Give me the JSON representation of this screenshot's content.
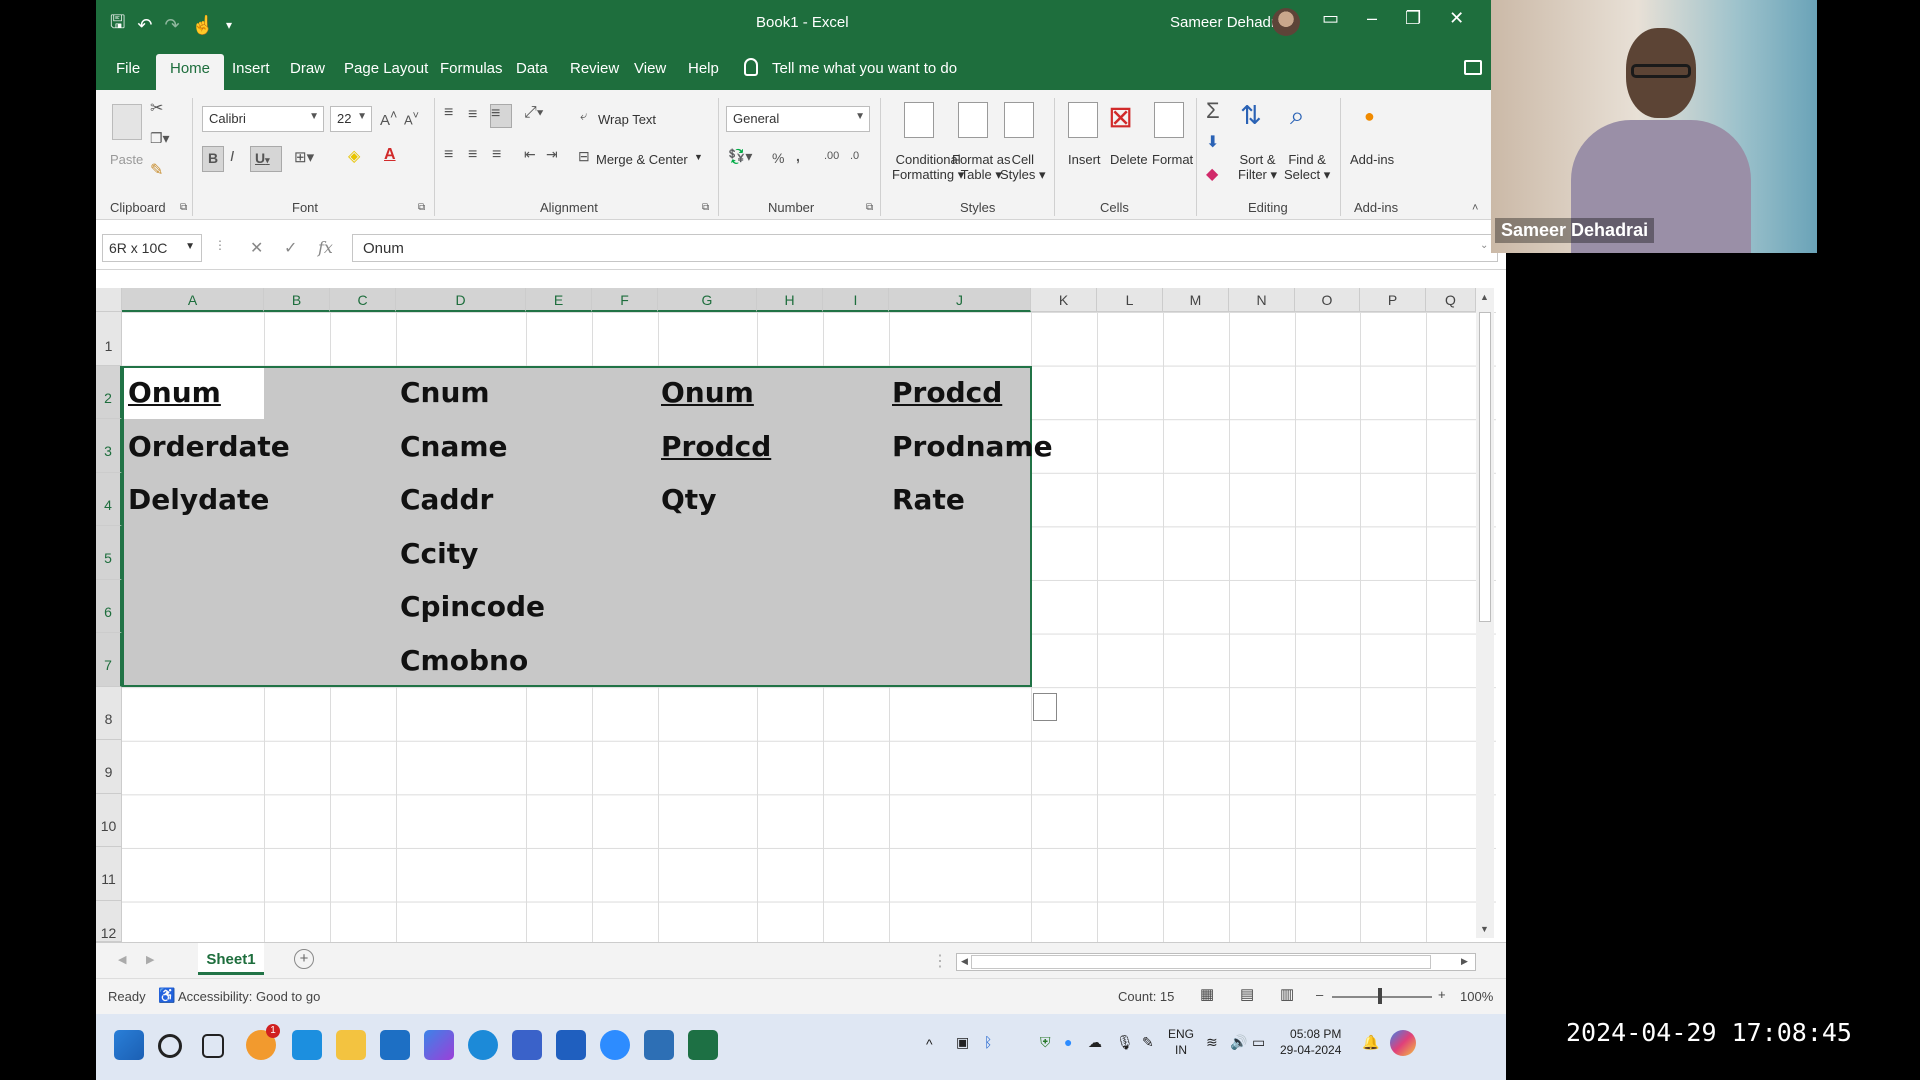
{
  "window": {
    "title": "Book1  -  Excel",
    "user": "Sameer Dehadrai"
  },
  "menu": {
    "tabs": [
      "File",
      "Home",
      "Insert",
      "Draw",
      "Page Layout",
      "Formulas",
      "Data",
      "Review",
      "View",
      "Help"
    ],
    "active_tab": "Home",
    "tell_me": "Tell me what you want to do"
  },
  "ribbon": {
    "clipboard": {
      "label": "Clipboard",
      "paste": "Paste"
    },
    "font": {
      "label": "Font",
      "name": "Calibri",
      "size": "22"
    },
    "alignment": {
      "label": "Alignment",
      "wrap_text": "Wrap Text",
      "merge_center": "Merge & Center"
    },
    "number": {
      "label": "Number",
      "format": "General"
    },
    "styles": {
      "label": "Styles",
      "conditional_1": "Conditional",
      "conditional_2": "Formatting",
      "format_table_1": "Format as",
      "format_table_2": "Table",
      "cell_styles_1": "Cell",
      "cell_styles_2": "Styles"
    },
    "cells": {
      "label": "Cells",
      "insert": "Insert",
      "delete": "Delete",
      "format": "Format"
    },
    "editing": {
      "label": "Editing",
      "sort_1": "Sort &",
      "sort_2": "Filter",
      "find_1": "Find &",
      "find_2": "Select"
    },
    "addins": {
      "label": "Add-ins",
      "button": "Add-ins"
    }
  },
  "formula_bar": {
    "name_box": "6R x 10C",
    "fx": "fx",
    "content": "Onum"
  },
  "grid": {
    "columns": [
      "A",
      "B",
      "C",
      "D",
      "E",
      "F",
      "G",
      "H",
      "I",
      "J",
      "K",
      "L",
      "M",
      "N",
      "O",
      "P",
      "Q"
    ],
    "rows": [
      "1",
      "2",
      "3",
      "4",
      "5",
      "6",
      "7",
      "8",
      "9",
      "10",
      "11",
      "12"
    ],
    "cells": {
      "A2": "Onum",
      "A3": "Orderdate",
      "A4": "Delydate",
      "D2": "Cnum",
      "D3": "Cname",
      "D4": "Caddr",
      "D5": "Ccity",
      "D6": "Cpincode",
      "D7": "Cmobno",
      "G2": "Onum",
      "G3": "Prodcd",
      "G4": "Qty",
      "J2": "Prodcd",
      "J3": "Prodname",
      "J4": "Rate"
    }
  },
  "sheets": {
    "tabs": [
      "Sheet1"
    ]
  },
  "status": {
    "ready": "Ready",
    "accessibility": "Accessibility: Good to go",
    "count": "Count: 15",
    "zoom": "100%"
  },
  "taskbar": {
    "lang_1": "ENG",
    "lang_2": "IN",
    "time": "05:08 PM",
    "date": "29-04-2024",
    "notification_count": "1"
  },
  "webcam": {
    "name": "Sameer Dehadrai"
  },
  "recording_timestamp": "2024-04-29 17:08:45",
  "colors": {
    "excel_green": "#1e6e3d",
    "selection_border": "#217346",
    "selection_fill": "#c8c8c8"
  }
}
